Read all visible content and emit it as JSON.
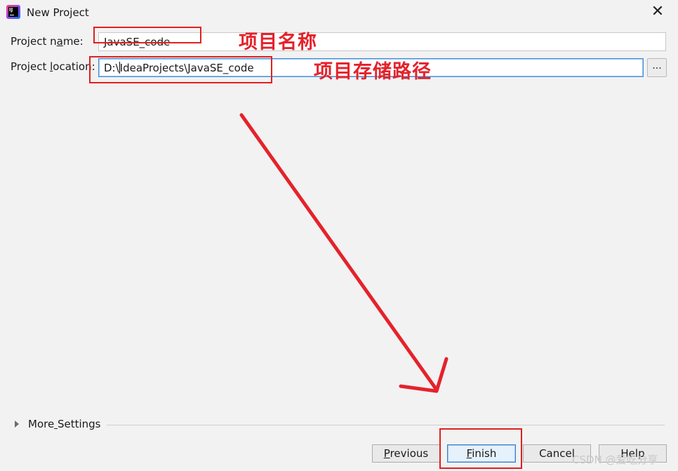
{
  "window": {
    "title": "New Project",
    "icon": "intellij-idea-icon",
    "close_glyph": "✕"
  },
  "form": {
    "name_label_pre": "Project n",
    "name_label_mnemonic": "a",
    "name_label_post": "me:",
    "name_value": "JavaSE_code",
    "location_label_pre": "Project ",
    "location_label_mnemonic": "l",
    "location_label_post": "ocation:",
    "location_value_pre": "D:\\",
    "location_value_post": "IdeaProjects\\JavaSE_code",
    "browse_label": "..."
  },
  "more_settings": {
    "pre": "More",
    "mnemonic": " ",
    "post": "Settings",
    "expanded": false
  },
  "buttons": {
    "previous_mnemonic": "P",
    "previous_rest": "revious",
    "finish_mnemonic": "F",
    "finish_rest": "inish",
    "cancel": "Cancel",
    "help": "Help"
  },
  "annotations": {
    "name_note": "项目名称",
    "location_note": "项目存储路径",
    "color": "#e5222b"
  },
  "watermark": "CSDN @爱吃分享"
}
